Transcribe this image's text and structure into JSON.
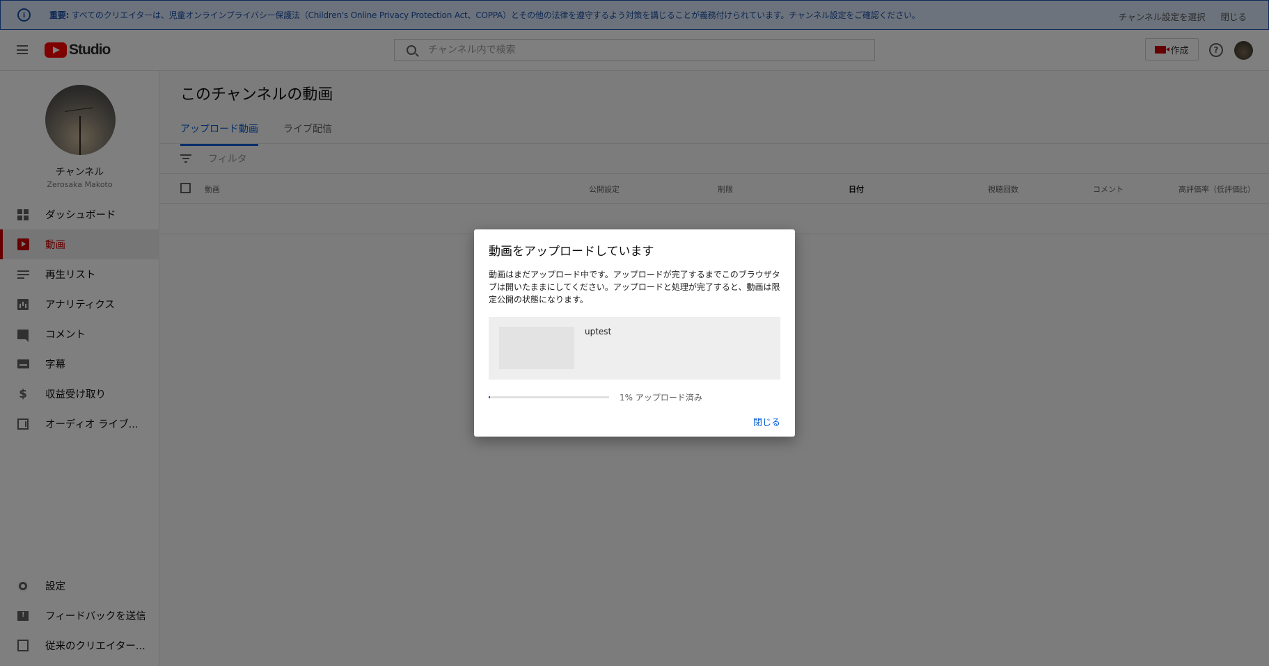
{
  "banner": {
    "message_bold": "重要:",
    "message": "すべてのクリエイターは、児童オンラインプライバシー保護法（Children's Online Privacy Protection Act、COPPA）とその他の法律を遵守するよう対策を講じることが義務付けられています。チャンネル設定をご確認ください。",
    "select_channel_settings": "チャンネル設定を選択",
    "close": "閉じる"
  },
  "header": {
    "logo_text": "Studio",
    "search_placeholder": "チャンネル内で検索",
    "create_label": "作成",
    "help_glyph": "?"
  },
  "sidebar": {
    "channel_name": "チャンネル",
    "channel_user": "Zerosaka Makoto",
    "items": [
      {
        "label": "ダッシュボード",
        "icon": "dashboard-icon"
      },
      {
        "label": "動画",
        "icon": "video-icon",
        "active": true
      },
      {
        "label": "再生リスト",
        "icon": "playlist-icon"
      },
      {
        "label": "アナリティクス",
        "icon": "analytics-icon"
      },
      {
        "label": "コメント",
        "icon": "comment-icon"
      },
      {
        "label": "字幕",
        "icon": "subtitles-icon"
      },
      {
        "label": "収益受け取り",
        "icon": "dollar-icon"
      },
      {
        "label": "オーディオ ライブ...",
        "icon": "audio-library-icon"
      }
    ],
    "bottom_items": [
      {
        "label": "設定",
        "icon": "gear-icon"
      },
      {
        "label": "フィードバックを送信",
        "icon": "feedback-icon"
      },
      {
        "label": "従来のクリエイター...",
        "icon": "legacy-creator-icon"
      }
    ]
  },
  "main": {
    "title": "このチャンネルの動画",
    "tabs": [
      {
        "label": "アップロード動画",
        "active": true
      },
      {
        "label": "ライブ配信"
      }
    ],
    "filter_placeholder": "フィルタ",
    "columns": [
      "動画",
      "公開設定",
      "制限",
      "日付",
      "視聴回数",
      "コメント",
      "高評価率（低評価比）"
    ]
  },
  "dialog": {
    "title": "動画をアップロードしています",
    "description": "動画はまだアップロード中です。アップロードが完了するまでこのブラウザタブは開いたままにしてください。アップロードと処理が完了すると、動画は限定公開の状態になります。",
    "file_name": "uptest",
    "progress_percent": 1,
    "progress_text": "1% アップロード済み",
    "close_label": "閉じる"
  },
  "colors": {
    "accent": "#065fd4",
    "brand": "#ff0000",
    "active_nav": "#cc0000"
  }
}
